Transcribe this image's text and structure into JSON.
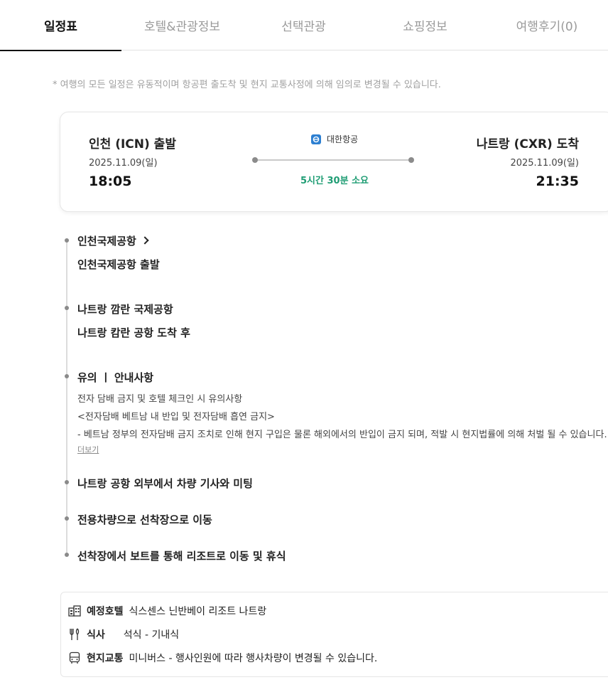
{
  "tabs": [
    {
      "label": "일정표",
      "active": true
    },
    {
      "label": "호텔&관광정보",
      "active": false
    },
    {
      "label": "선택관광",
      "active": false
    },
    {
      "label": "쇼핑정보",
      "active": false
    },
    {
      "label": "여행후기(0)",
      "active": false
    }
  ],
  "notice": "* 여행의 모든 일정은 유동적이며 항공편 출도착 및 현지 교통사정에 의해 임의로 변경될 수 있습니다.",
  "flight": {
    "departure": {
      "title": "인천 (ICN) 출발",
      "date": "2025.11.09(일)",
      "time": "18:05"
    },
    "arrival": {
      "title": "나트랑 (CXR) 도착",
      "date": "2025.11.09(일)",
      "time": "21:35"
    },
    "airline": "대한항공",
    "duration": "5시간 30분 소요",
    "accent_color": "#1f9d74"
  },
  "timeline": {
    "item1": {
      "title": "인천국제공항",
      "sub": "인천국제공항 출발"
    },
    "item2": {
      "title": "나트랑 깜란 국제공항",
      "sub": "나트랑 캄란 공항 도착 후"
    },
    "item3": {
      "title": "유의 ㅣ 안내사항",
      "lines": [
        "전자 담배 금지 및 호텔 체크인 시 유의사항",
        "<전자담배 베트남 내 반입 및 전자담배 흡연 금지>",
        "- 베트남 정부의 전자담배 금지 조치로 인해 현지 구입은 물론 해외에서의 반입이 금지 되며, 적발 시 현지법률에 의해 처벌 될 수 있습니다."
      ],
      "more": "더보기"
    },
    "item4": {
      "title": "나트랑 공항 외부에서 차량 기사와 미팅"
    },
    "item5": {
      "title": "전용차량으로 선착장으로 이동"
    },
    "item6": {
      "title": "선착장에서 보트를 통해 리조트로 이동 및 휴식"
    }
  },
  "info": {
    "hotel": {
      "label": "예정호텔",
      "value": "식스센스 닌반베이 리조트 나트랑",
      "icon": "hotel-icon"
    },
    "meal": {
      "label": "식사",
      "value": "석식 - 기내식",
      "icon": "utensils-icon"
    },
    "transport": {
      "label": "현지교통",
      "value": "미니버스 - 행사인원에 따라 행사차량이 변경될 수 있습니다.",
      "icon": "bus-icon"
    }
  }
}
